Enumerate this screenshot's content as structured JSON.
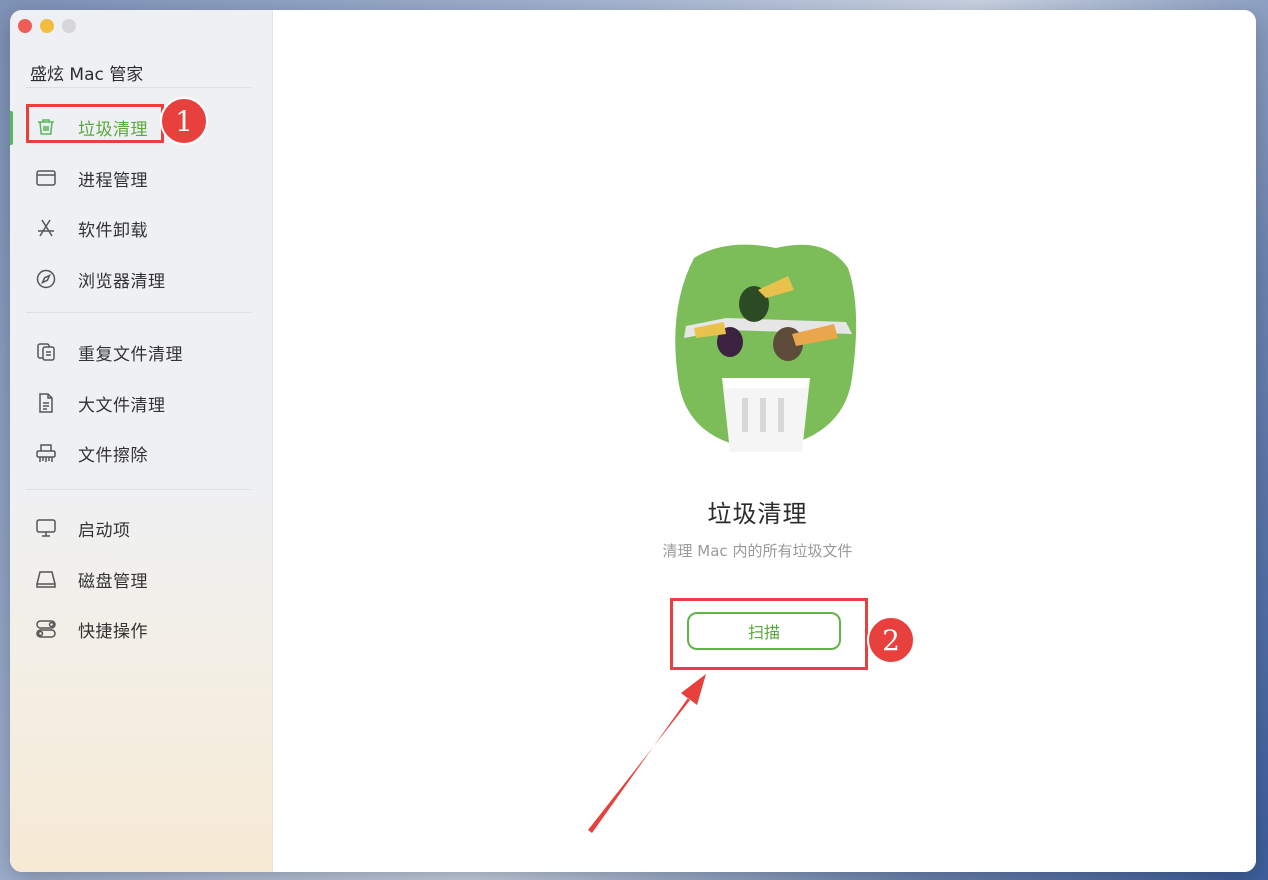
{
  "app": {
    "title": "盛炫 Mac 管家"
  },
  "sidebar": {
    "groups": [
      [
        {
          "label": "垃圾清理",
          "icon": "trash-icon",
          "active": true
        },
        {
          "label": "进程管理",
          "icon": "window-icon"
        },
        {
          "label": "软件卸载",
          "icon": "app-store-icon"
        },
        {
          "label": "浏览器清理",
          "icon": "compass-icon"
        }
      ],
      [
        {
          "label": "重复文件清理",
          "icon": "copy-icon"
        },
        {
          "label": "大文件清理",
          "icon": "document-icon"
        },
        {
          "label": "文件擦除",
          "icon": "shredder-icon"
        }
      ],
      [
        {
          "label": "启动项",
          "icon": "monitor-icon"
        },
        {
          "label": "磁盘管理",
          "icon": "disk-icon"
        },
        {
          "label": "快捷操作",
          "icon": "toggles-icon"
        }
      ]
    ]
  },
  "main": {
    "title": "垃圾清理",
    "subtitle": "清理 Mac 内的所有垃圾文件",
    "scan_label": "扫描"
  },
  "annotations": {
    "step1": "1",
    "step2": "2",
    "color": "#e8403c"
  },
  "colors": {
    "accent": "#5cb85c",
    "hero_green": "#7cbd5a"
  }
}
